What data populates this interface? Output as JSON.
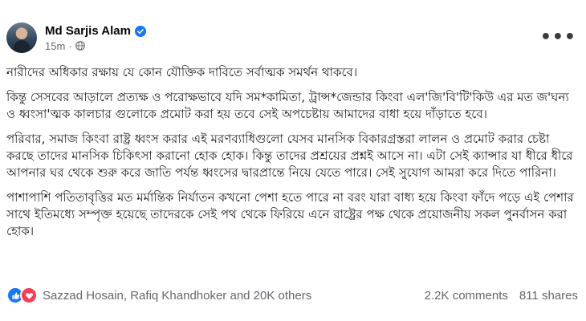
{
  "post": {
    "author": "Md Sarjis Alam",
    "time": "15m",
    "more_label": "•••",
    "icons": {
      "verified": "verified-badge-icon",
      "audience": "globe-icon",
      "like": "like-reaction-icon",
      "love": "love-reaction-icon"
    },
    "accent_color": "#1877f2",
    "love_color": "#f33e58",
    "paragraphs": [
      "নারীদের অধিকার রক্ষায় যে কোন যৌক্তিক দাবিতে সর্বাত্মক সমর্থন থাকবে।",
      "কিন্তু সেসবের আড়ালে প্রত্যক্ষ ও পরোক্ষভাবে যদি সম*কামিতা, ট্রান্স*জেন্ডার কিংবা এল'জি'বি'টি'কিউ এর মত জ'ঘন্য ও ধ্বংসা'ত্মক কালচার গুলোকে প্রমোট করা হয় তবে সেই অপচেষ্টায় আমাদের বাধা হয়ে দাঁড়াতে হবে।",
      "পরিবার, সমাজ কিংবা রাষ্ট্র ধ্বংস করার এই মরণব্যাধিগুলো যেসব মানসিক বিকারগ্রস্তরা লালন ও প্রমোট করার চেষ্টা করছে তাদের মানসিক চিকিৎসা করানো হোক হোক। কিন্তু তাদের প্রশ্রয়ের প্রশ্নই আসে না। এটা সেই ক্যান্সার যা ধীরে ধীরে আপনার ঘর থেকে শুরু করে জাতি পর্যন্ত ধ্বংসের দ্বারপ্রান্তে নিয়ে যেতে পারে। সেই সুযোগ আমরা করে দিতে পারিনা।",
      "পাশাপাশি পতিতাবৃত্তির মত মর্মান্তিক নির্যাতন কখনো পেশা হতে পারে না বরং যারা বাধ্য হয়ে কিংবা ফাঁদে পড়ে এই পেশার সাথে ইতিমধ্যে সম্পৃক্ত হয়েছে তাদেরকে সেই পথ থেকে ফিরিয়ে এনে রাষ্ট্রের পক্ষ থেকে প্রয়োজনীয় সকল পুনর্বাসন করা হোক।"
    ],
    "reaction_names": "Sazzad Hosain, Rafiq Khandhoker and 20K others",
    "comments": "2.2K comments",
    "shares": "811 shares"
  }
}
